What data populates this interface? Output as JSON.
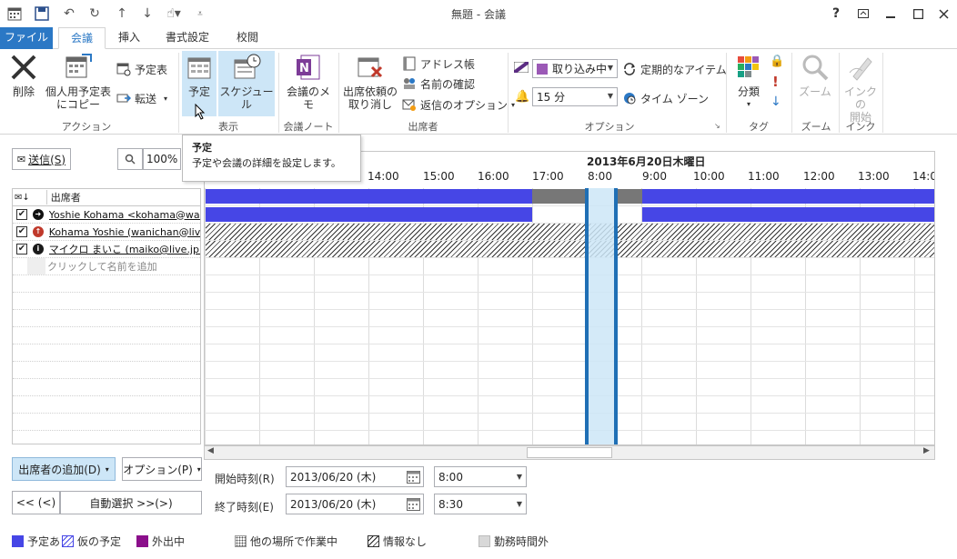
{
  "window": {
    "title": "無題 - 会議",
    "help": "?"
  },
  "tabs": [
    {
      "label": "ファイル"
    },
    {
      "label": "会議"
    },
    {
      "label": "挿入"
    },
    {
      "label": "書式設定"
    },
    {
      "label": "校閲"
    }
  ],
  "ribbon": {
    "delete": "削除",
    "copy_personal_1": "個人用予定表",
    "copy_personal_2": "にコピー",
    "calendar": "予定表",
    "forward": "転送",
    "group_action": "アクション",
    "appointment": "予定",
    "schedule": "スケジュール",
    "group_show": "表示",
    "meeting_notes": "会議のメモ",
    "group_notes": "会議ノート",
    "cancel_invite_1": "出席依頼の",
    "cancel_invite_2": "取り消し",
    "address_book": "アドレス帳",
    "check_names": "名前の確認",
    "response_options": "返信のオプション",
    "group_attendees": "出席者",
    "show_as": "取り込み中",
    "reminder": "15 分",
    "recurrence": "定期的なアイテム",
    "time_zones": "タイム ゾーン",
    "group_options": "オプション",
    "categorize": "分類",
    "group_tags": "タグ",
    "zoom": "ズーム",
    "group_zoom": "ズーム",
    "ink_1": "インクの",
    "ink_2": "開始",
    "group_ink": "インク"
  },
  "tooltip": {
    "title": "予定",
    "body": "予定や会議の詳細を設定します。"
  },
  "toolbar": {
    "send": "送信(S)",
    "zoom_level": "100%"
  },
  "attendees": {
    "header": "出席者",
    "rows": [
      {
        "name": "Yoshie Kohama <kohama@wanichan",
        "status_color": "#111111",
        "status_glyph": "➜"
      },
      {
        "name": "Kohama Yoshie (wanichan@live.jp",
        "status_color": "#c0392b",
        "status_glyph": "↑"
      },
      {
        "name": "マイクロ まいこ (maiko@live.jp)",
        "status_color": "#1a1a1a",
        "status_glyph": "i"
      }
    ],
    "add_placeholder": "クリックして名前を追加"
  },
  "schedule": {
    "date_header": "2013年6月20日木曜日",
    "times_left": [
      "14:00",
      "15:00",
      "16:00",
      "17:00"
    ],
    "times_right": [
      "8:00",
      "9:00",
      "10:00",
      "11:00",
      "12:00",
      "13:00",
      "14:0"
    ]
  },
  "bottom": {
    "add_attendees": "出席者の追加(D)",
    "options": "オプション(P)",
    "prev": "<< (<)",
    "autopick": "自動選択 >>(>)",
    "start_label": "開始時刻(R)",
    "end_label": "終了時刻(E)",
    "start_date": "2013/06/20 (木)",
    "start_time": "8:00",
    "end_date": "2013/06/20 (木)",
    "end_time": "8:30"
  },
  "legend": {
    "busy": "予定あ",
    "tentative": "仮の予定",
    "oof": "外出中",
    "elsewhere": "他の場所で作業中",
    "noinfo": "情報なし",
    "offhours": "勤務時間外"
  },
  "colors": {
    "accent": "#2b78c5",
    "busy": "#4646e6",
    "selection": "#cde6f7",
    "oof": "#8b0f8b"
  }
}
